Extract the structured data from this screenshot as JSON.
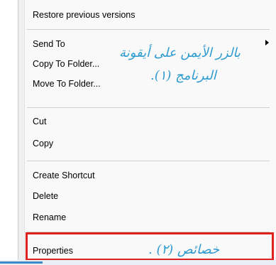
{
  "context_menu": {
    "items": [
      {
        "label": "Restore previous versions"
      },
      {
        "label": "Send To"
      },
      {
        "label": "Copy To Folder..."
      },
      {
        "label": "Move To Folder..."
      },
      {
        "label": "Cut"
      },
      {
        "label": "Copy"
      },
      {
        "label": "Create Shortcut"
      },
      {
        "label": "Delete"
      },
      {
        "label": "Rename"
      },
      {
        "label": "Properties"
      }
    ],
    "submenu_arrow_icon": "chevron-right-icon"
  },
  "annotations": {
    "line1": "بالزر الأيمن على أيقونة",
    "line2": "البرنامج (١).",
    "properties_note": "خصائص (٢) ."
  },
  "colors": {
    "highlight_border": "#e0201e",
    "annotation_text": "#2e9bd0"
  }
}
